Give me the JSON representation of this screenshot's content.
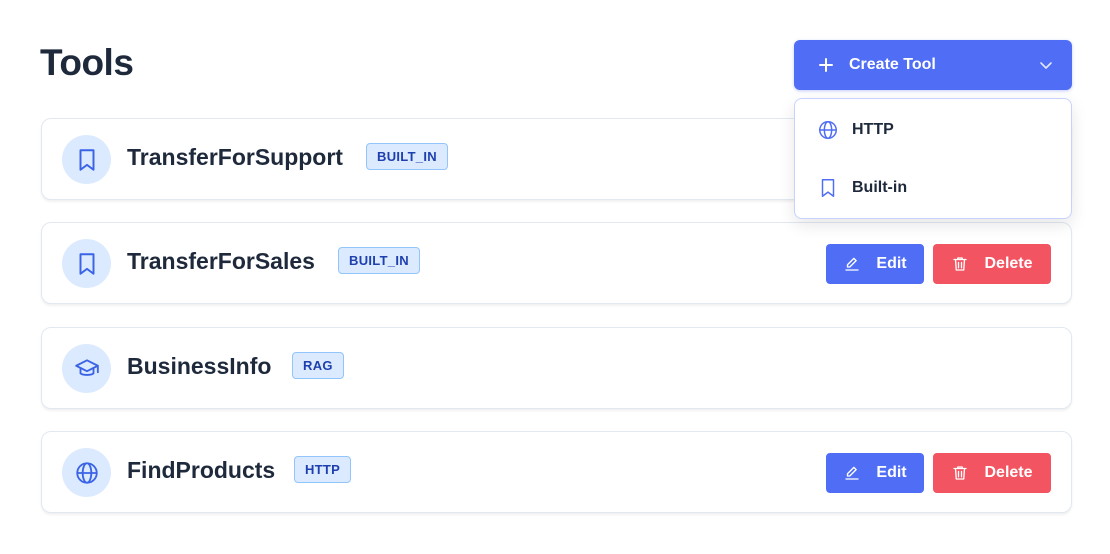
{
  "header": {
    "title": "Tools",
    "create_button": {
      "label": "Create Tool",
      "icon": "plus-icon",
      "chevron": "chevron-down-icon"
    }
  },
  "dropdown": {
    "items": [
      {
        "label": "HTTP",
        "icon": "globe-icon"
      },
      {
        "label": "Built-in",
        "icon": "bookmark-icon"
      }
    ]
  },
  "tools": [
    {
      "name": "TransferForSupport",
      "badge": "BUILT_IN",
      "icon": "bookmark-icon",
      "has_actions": true
    },
    {
      "name": "TransferForSales",
      "badge": "BUILT_IN",
      "icon": "bookmark-icon",
      "has_actions": true
    },
    {
      "name": "BusinessInfo",
      "badge": "RAG",
      "icon": "graduation-cap-icon",
      "has_actions": false
    },
    {
      "name": "FindProducts",
      "badge": "HTTP",
      "icon": "globe-icon",
      "has_actions": true
    }
  ],
  "actions": {
    "edit_label": "Edit",
    "delete_label": "Delete"
  },
  "colors": {
    "primary": "#4f6df5",
    "danger": "#f25461",
    "badge_bg": "#dbeafe",
    "badge_text": "#1e40af",
    "title": "#1e293b"
  }
}
